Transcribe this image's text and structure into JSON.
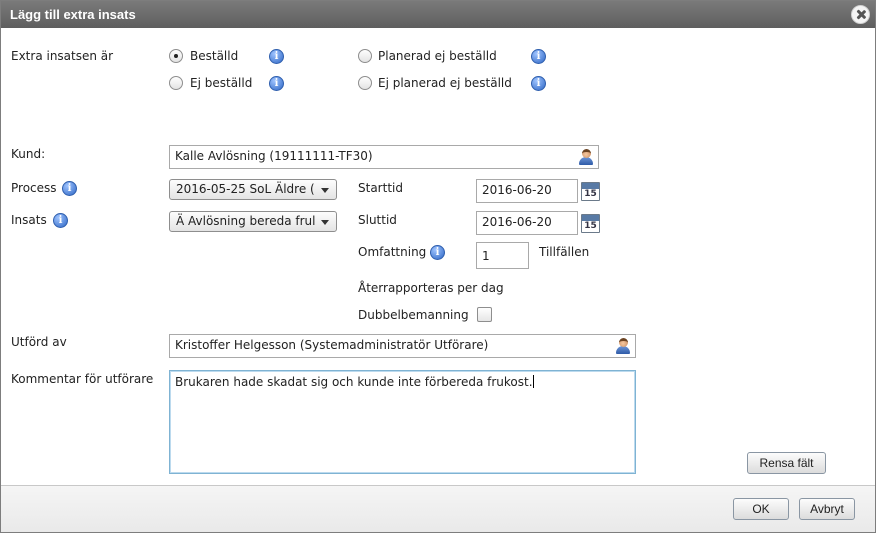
{
  "dialog": {
    "title": "Lägg till extra insats"
  },
  "status": {
    "label": "Extra insatsen är",
    "options": [
      {
        "label": "Beställd",
        "checked": true
      },
      {
        "label": "Ej beställd",
        "checked": false
      },
      {
        "label": "Planerad ej beställd",
        "checked": false
      },
      {
        "label": "Ej planerad ej beställd",
        "checked": false
      }
    ]
  },
  "kund": {
    "label": "Kund:",
    "value": "Kalle Avlösning (19111111-TF30)"
  },
  "process": {
    "label": "Process",
    "value": "2016-05-25 SoL Äldre ("
  },
  "insats": {
    "label": "Insats",
    "value": "Ä Avlösning bereda frul"
  },
  "starttid": {
    "label": "Starttid",
    "value": "2016-06-20"
  },
  "sluttid": {
    "label": "Sluttid",
    "value": "2016-06-20"
  },
  "calendar_day": "15",
  "omfattning": {
    "label": "Omfattning",
    "value": "1",
    "unit": "Tillfällen"
  },
  "aterrapporteras": "Återrapporteras per dag",
  "dubbelbemanning": {
    "label": "Dubbelbemanning",
    "checked": false
  },
  "utford_av": {
    "label": "Utförd av",
    "value": "Kristoffer Helgesson (Systemadministratör Utförare)"
  },
  "kommentar": {
    "label": "Kommentar för utförare",
    "value": "Brukaren hade skadat sig och kunde inte förbereda frukost."
  },
  "info_glyph": "i",
  "buttons": {
    "rensa": "Rensa fält",
    "ok": "OK",
    "avbryt": "Avbryt"
  },
  "colors": {
    "titlebar": "#6b6b6b",
    "info": "#2e66c4",
    "textarea_border": "#7fb3d3"
  }
}
